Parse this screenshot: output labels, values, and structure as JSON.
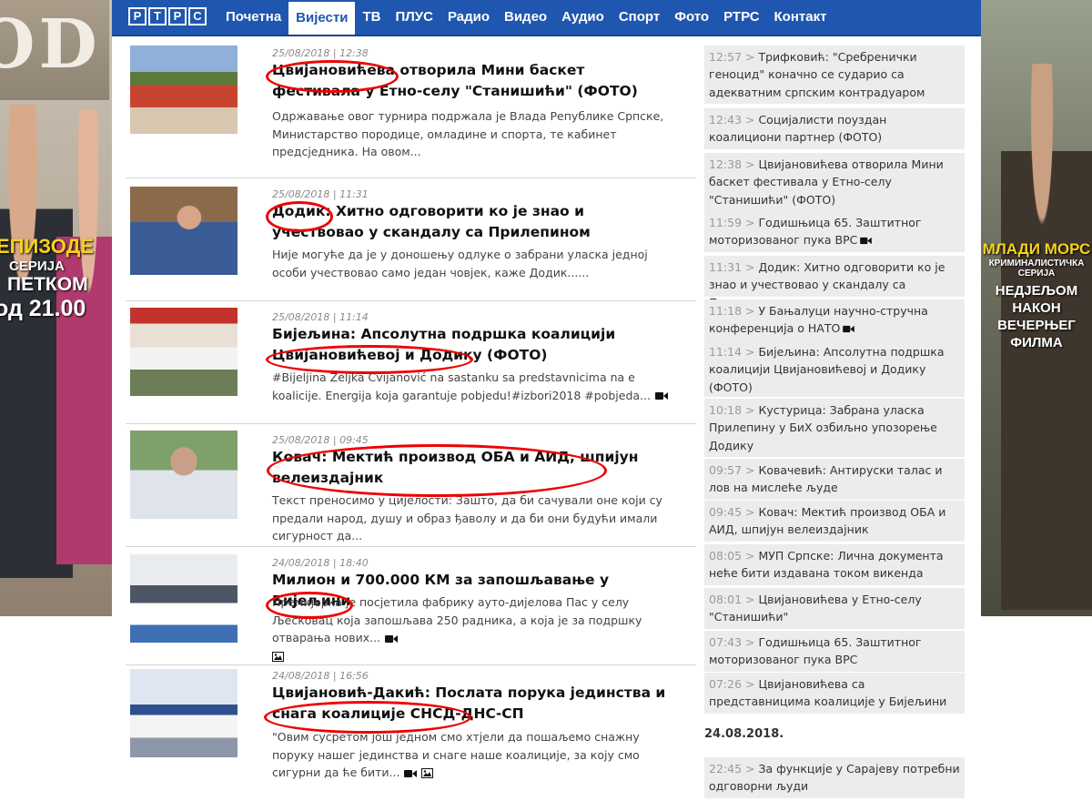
{
  "ad_left": {
    "sign_text": "OD",
    "line1": "ЕПИЗОДЕ",
    "line2": "СЕРИЈА",
    "line3": "ПЕТКОМ",
    "line4": "од 21.00"
  },
  "ad_right": {
    "line1": "МЛАДИ МОРС",
    "line2": "КРИМИНАЛИСТИЧКА СЕРИЈА",
    "line3": "НЕДЈЕЉОМ",
    "line4": "НАКОН",
    "line5": "ВЕЧЕРЊЕГ",
    "line6": "ФИЛМА"
  },
  "nav": {
    "logo_letters": [
      "Р",
      "Т",
      "Р",
      "С"
    ],
    "items": [
      "Почетна",
      "Вијести",
      "ТВ",
      "ПЛУС",
      "Радио",
      "Видео",
      "Аудио",
      "Спорт",
      "Фото",
      "РТРС",
      "Контакт"
    ],
    "active": "Вијести"
  },
  "articles": [
    {
      "meta": "25/08/2018 | 12:38",
      "title": "Цвијановићева отворила Мини баскет фестивала у Етно-селу \"Станишићи\" (ФОТО)",
      "excerpt": "Одржавање овог турнира подржала је Влада Републике Српске, Министарство породице, омладине и спорта, те кабинет предсједника. На овом...",
      "icons": []
    },
    {
      "meta": "25/08/2018 | 11:31",
      "title": "Додик: Хитно одговорити ко је знао и учествовао у скандалу са Прилепином",
      "excerpt": "Није могуће да је у доношењу одлуке о забрани уласка једној особи учествовао само један човјек, каже Додик......",
      "icons": []
    },
    {
      "meta": "25/08/2018 | 11:14",
      "title": "Бијељина: Апсолутна подршка коалицији Цвијановићевој и Додику (ФОТО)",
      "excerpt": "#Bijeljina Željka Cvijanović na sastanku sa predstavnicima na e koalicije. Energija koja garantuje pobjedu!#izbori2018 #pobjeda...",
      "icons": [
        "camera-icon"
      ]
    },
    {
      "meta": "25/08/2018 | 09:45",
      "title": "Ковач: Мектић производ ОБА и АИД, шпијун велеиздајник",
      "excerpt": "Текст преносимо у цијелости: Зашто, да би сачували оне који су предали народ, душу и образ ђаволу и да би они будући имали сигурност да...",
      "icons": []
    },
    {
      "meta": "24/08/2018 | 18:40",
      "title": "Милион и 700.000 КМ за запошљавање у Бијељини",
      "excerpt": "Премијерка је посјетила фабрику ауто-дијелова Пас у селу Љесковац која запошљава 250 радника, а која је за подршку отварања нових...",
      "icons": [
        "camera-icon",
        "image-icon"
      ]
    },
    {
      "meta": "24/08/2018 | 16:56",
      "title": "Цвијановић-Дакић: Послата порука јединства и снага коалиције СНСД-ДНС-СП",
      "excerpt": "\"Овим сусретом још једном смо хтјели да пошаљемо снажну поруку нашег јединства и снаге наше коалиције, за коју смо сигурни да ће бити...",
      "icons": [
        "camera-icon",
        "image-icon"
      ]
    }
  ],
  "sidebar": {
    "items": [
      {
        "time": "12:57",
        "text": "Трифковић: \"Сребренички геноцид\" коначно се сударио са адекватним српским контрадуаром",
        "video": false
      },
      {
        "time": "12:43",
        "text": "Социјалисти поуздан коалициони партнер (ФОТО)",
        "video": false
      },
      {
        "time": "12:38",
        "text": "Цвијановићева отворила Мини баскет фестивала у Етно-селу \"Станишићи\" (ФОТО)",
        "video": false
      },
      {
        "time": "11:59",
        "text": "Годишњица 65. Заштитног моторизованог пука ВРС",
        "video": true
      },
      {
        "time": "11:31",
        "text": "Додик: Хитно одговорити ко је знао и учествовао у скандалу са Прилепином",
        "video": false
      },
      {
        "time": "11:18",
        "text": "У Бањалуци научно-стручна конференција о НАТО",
        "video": true
      },
      {
        "time": "11:14",
        "text": "Бијељина: Апсолутна подршка коалицији Цвијановићевој и Додику (ФОТО)",
        "video": true
      },
      {
        "time": "10:18",
        "text": "Кустурица: Забрана уласка Прилепину у БиХ озбиљно упозорење Додику",
        "video": false
      },
      {
        "time": "09:57",
        "text": "Ковачевић: Антируски талас и лов на мислеће људе",
        "video": false
      },
      {
        "time": "09:45",
        "text": "Ковач: Мектић производ ОБА и АИД, шпијун велеиздајник",
        "video": false
      },
      {
        "time": "08:05",
        "text": "МУП Српске: Лична документа неће бити издавана током викенда",
        "video": false
      },
      {
        "time": "08:01",
        "text": "Цвијановићева у Етно-селу \"Станишићи\"",
        "video": false
      },
      {
        "time": "07:43",
        "text": "Годишњица 65. Заштитног моторизованог пука ВРС",
        "video": false
      },
      {
        "time": "07:26",
        "text": "Цвијановићева са представницима коалиције у Бијељини",
        "video": false
      }
    ],
    "date_heading": "24.08.2018.",
    "after_date": {
      "time": "22:45",
      "text": "За функције у Сарајеву потребни одговорни људи",
      "video": false
    }
  }
}
